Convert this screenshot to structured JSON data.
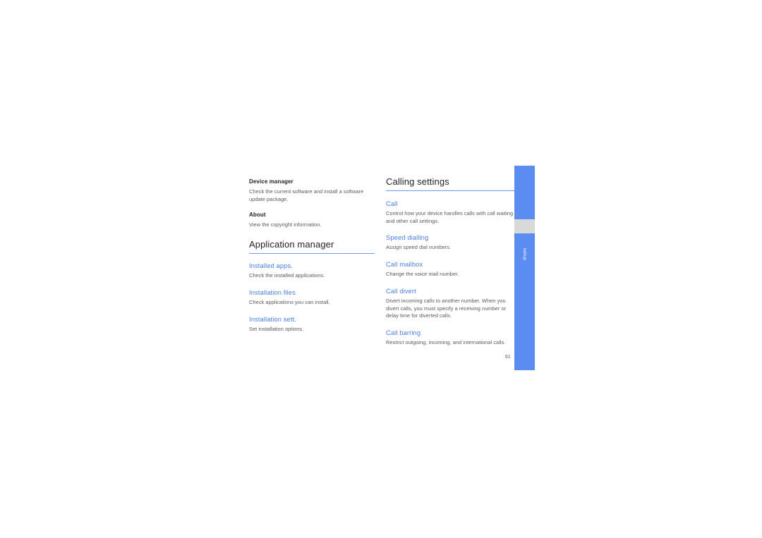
{
  "document": {
    "page_number": "61",
    "side_tab_label": "setup",
    "accent_color": "#5b8df0",
    "heading_color": "#4a7fe0",
    "body_color": "#58595b"
  },
  "left_column": {
    "items": [
      {
        "title": "Device manager",
        "style": "bold-small",
        "body": "Check the current software and install a software update package."
      },
      {
        "title": "About",
        "style": "bold-small",
        "body": "View the copyright information."
      }
    ],
    "section_title": "Application manager",
    "entries": [
      {
        "title": "Installed apps.",
        "body": "Check the installed applications."
      },
      {
        "title": "Installation files",
        "body": "Check applications you can install."
      },
      {
        "title": "Installation sett.",
        "body": "Set installation options."
      }
    ]
  },
  "right_column": {
    "section_title": "Calling settings",
    "entries": [
      {
        "title": "Call",
        "body": "Control how your device handles calls with call waiting and other call settings."
      },
      {
        "title": "Speed dialling",
        "body": "Assign speed dial numbers."
      },
      {
        "title": "Call mailbox",
        "body": "Change the voice mail number."
      },
      {
        "title": "Call divert",
        "body": "Divert incoming calls to another number. When you divert calls, you must specify a receiving number or delay time for diverted calls."
      },
      {
        "title": "Call barring",
        "body": "Restrict outgoing, incoming, and international calls."
      }
    ]
  }
}
